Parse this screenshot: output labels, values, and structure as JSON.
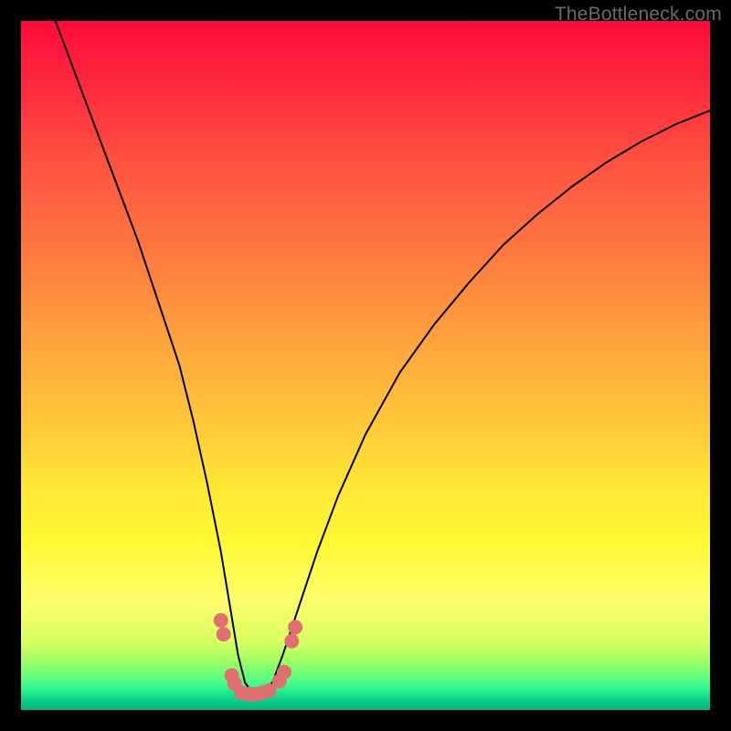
{
  "watermark": "TheBottleneck.com",
  "chart_data": {
    "type": "line",
    "title": "",
    "xlabel": "",
    "ylabel": "",
    "xlim": [
      0,
      100
    ],
    "ylim": [
      0,
      100
    ],
    "series": [
      {
        "name": "bottleneck-curve",
        "x": [
          5,
          8,
          11,
          14,
          17,
          20,
          23,
          25,
          27,
          29,
          30.5,
          31.5,
          32.5,
          33.5,
          35,
          36.5,
          38,
          40,
          43,
          46,
          50,
          55,
          60,
          65,
          70,
          75,
          80,
          85,
          90,
          95,
          100
        ],
        "values": [
          100,
          92,
          84,
          76,
          68,
          59,
          50,
          42,
          33,
          23,
          14,
          8,
          4,
          2.5,
          2.5,
          4,
          8,
          14,
          23,
          31,
          40,
          49,
          56,
          62,
          67.5,
          72,
          76,
          79.5,
          82.5,
          85,
          87
        ]
      }
    ],
    "markers": {
      "name": "highlight-dots",
      "color": "#e07070",
      "points": [
        {
          "x": 29.0,
          "y": 13.0
        },
        {
          "x": 29.4,
          "y": 11.0
        },
        {
          "x": 30.6,
          "y": 5.0
        },
        {
          "x": 31.0,
          "y": 3.8
        },
        {
          "x": 32.0,
          "y": 2.5
        },
        {
          "x": 33.0,
          "y": 2.3
        },
        {
          "x": 34.0,
          "y": 2.3
        },
        {
          "x": 35.0,
          "y": 2.5
        },
        {
          "x": 36.0,
          "y": 2.8
        },
        {
          "x": 37.5,
          "y": 4.2
        },
        {
          "x": 38.2,
          "y": 5.5
        },
        {
          "x": 39.3,
          "y": 10.0
        },
        {
          "x": 39.8,
          "y": 12.0
        }
      ]
    }
  }
}
